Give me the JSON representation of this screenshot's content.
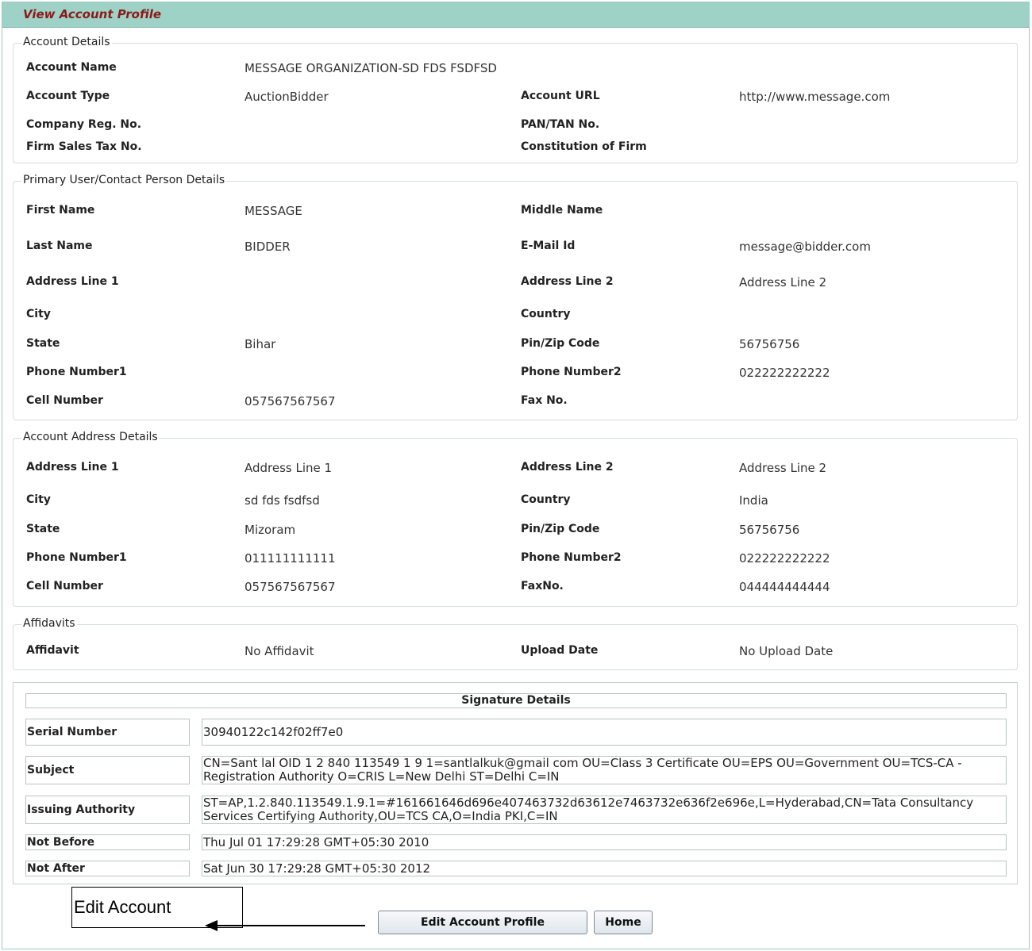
{
  "header": {
    "title": "View Account Profile"
  },
  "account_details": {
    "legend": "Account Details",
    "account_name_label": "Account Name",
    "account_name": "MESSAGE ORGANIZATION-SD FDS FSDFSD",
    "account_type_label": "Account Type",
    "account_type": "AuctionBidder",
    "account_url_label": "Account URL",
    "account_url": "http://www.message.com",
    "company_reg_label": "Company Reg. No.",
    "company_reg": "",
    "pan_tan_label": "PAN/TAN No.",
    "pan_tan": "",
    "firm_sales_tax_label": "Firm Sales Tax No.",
    "firm_sales_tax": "",
    "constitution_label": "Constitution of Firm",
    "constitution": ""
  },
  "primary_contact": {
    "legend": "Primary User/Contact Person Details",
    "first_name_label": "First Name",
    "first_name": "MESSAGE",
    "middle_name_label": "Middle Name",
    "middle_name": "",
    "last_name_label": "Last Name",
    "last_name": "BIDDER",
    "email_label": "E-Mail Id",
    "email": "message@bidder.com",
    "address1_label": "Address Line 1",
    "address1": "",
    "address2_label": "Address Line 2",
    "address2": "Address Line 2",
    "city_label": "City",
    "city": "",
    "country_label": "Country",
    "country": "",
    "state_label": "State",
    "state": "Bihar",
    "pin_label": "Pin/Zip Code",
    "pin": "56756756",
    "phone1_label": "Phone Number1",
    "phone1": "",
    "phone2_label": "Phone Number2",
    "phone2": "022222222222",
    "cell_label": "Cell Number",
    "cell": "057567567567",
    "fax_label": "Fax No.",
    "fax": ""
  },
  "account_address": {
    "legend": "Account Address Details",
    "address1_label": "Address Line 1",
    "address1": "Address Line 1",
    "address2_label": "Address Line 2",
    "address2": "Address Line 2",
    "city_label": "City",
    "city": "sd fds fsdfsd",
    "country_label": "Country",
    "country": "India",
    "state_label": "State",
    "state": "Mizoram",
    "pin_label": "Pin/Zip Code",
    "pin": "56756756",
    "phone1_label": "Phone Number1",
    "phone1": "011111111111",
    "phone2_label": "Phone Number2",
    "phone2": "022222222222",
    "cell_label": "Cell Number",
    "cell": "057567567567",
    "fax_label": "FaxNo.",
    "fax": "044444444444"
  },
  "affidavits": {
    "legend": "Affidavits",
    "affidavit_label": "Affidavit",
    "affidavit": "No Affidavit",
    "upload_date_label": "Upload Date",
    "upload_date": "No Upload Date"
  },
  "signature": {
    "title": "Signature Details",
    "serial_label": "Serial Number",
    "serial": "30940122c142f02ff7e0",
    "subject_label": "Subject",
    "subject": "CN=Sant lal OID 1 2 840 113549 1 9 1=santlalkuk@gmail com OU=Class 3 Certificate OU=EPS OU=Government OU=TCS-CA - Registration Authority O=CRIS L=New Delhi ST=Delhi C=IN",
    "issuer_label": "Issuing Authority",
    "issuer": "ST=AP,1.2.840.113549.1.9.1=#161661646d696e407463732d63612e7463732e636f2e696e,L=Hyderabad,CN=Tata Consultancy Services Certifying Authority,OU=TCS CA,O=India PKI,C=IN",
    "not_before_label": "Not Before",
    "not_before": "Thu Jul 01 17:29:28 GMT+05:30 2010",
    "not_after_label": "Not After",
    "not_after": "Sat Jun 30 17:29:28 GMT+05:30 2012"
  },
  "actions": {
    "edit_label": "Edit Account Profile",
    "home_label": "Home",
    "callout_text": "Edit Account"
  }
}
